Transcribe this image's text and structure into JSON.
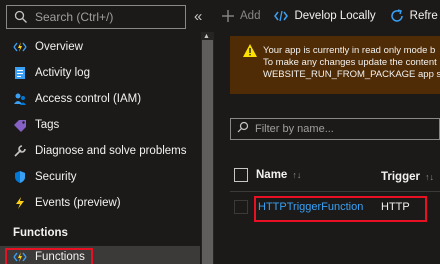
{
  "sidebar": {
    "search_placeholder": "Search (Ctrl+/)",
    "collapse_glyph": "«",
    "items": [
      {
        "label": "Overview",
        "icon": "function-bolt-icon"
      },
      {
        "label": "Activity log",
        "icon": "activity-log-icon"
      },
      {
        "label": "Access control (IAM)",
        "icon": "people-icon"
      },
      {
        "label": "Tags",
        "icon": "tag-icon"
      },
      {
        "label": "Diagnose and solve problems",
        "icon": "wrench-icon"
      },
      {
        "label": "Security",
        "icon": "shield-icon"
      },
      {
        "label": "Events (preview)",
        "icon": "lightning-icon"
      }
    ],
    "section_title": "Functions",
    "functions_item": {
      "label": "Functions",
      "icon": "function-icon",
      "selected": true
    }
  },
  "toolbar": {
    "add_label": "Add",
    "develop_label": "Develop Locally",
    "refresh_label": "Refre"
  },
  "warning": {
    "lines": [
      "Your app is currently in read only mode b",
      "To make any changes update the content",
      "WEBSITE_RUN_FROM_PACKAGE app setti"
    ]
  },
  "filter": {
    "placeholder": "Filter by name..."
  },
  "table": {
    "columns": [
      "Name",
      "Trigger"
    ],
    "sort_glyph": "↑↓",
    "rows": [
      {
        "name": "HTTPTriggerFunction",
        "trigger": "HTTP"
      }
    ]
  },
  "colors": {
    "accent_link": "#3aa0f3",
    "warning_bg": "#4f2c05",
    "highlight_border": "#e81123"
  }
}
